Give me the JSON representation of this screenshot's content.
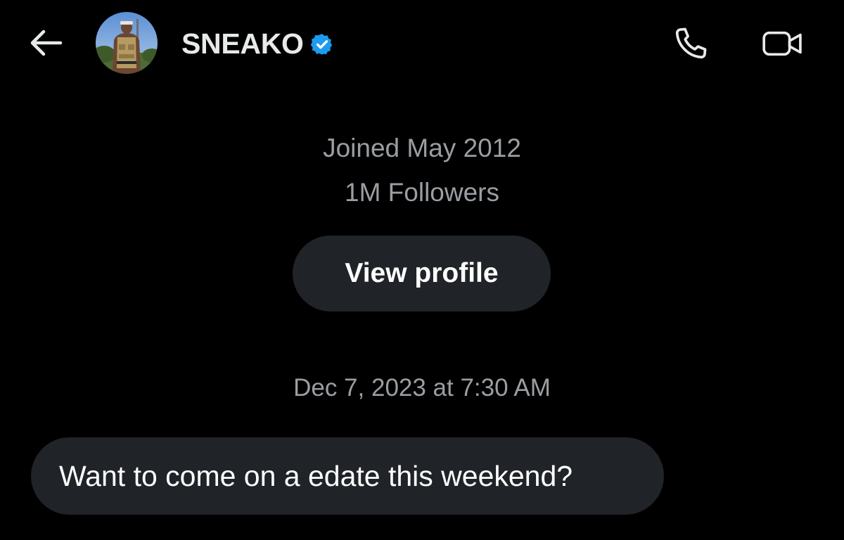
{
  "header": {
    "display_name": "SNEAKO",
    "avatar_icon": "avatar-photo",
    "back_icon": "arrow-left-icon",
    "verified_icon": "verified-badge-icon",
    "call_icon": "phone-icon",
    "video_icon": "video-camera-icon"
  },
  "profile": {
    "joined": "Joined May 2012",
    "followers": "1M Followers",
    "view_profile_label": "View profile"
  },
  "conversation": {
    "timestamp": "Dec 7, 2023 at 7:30 AM",
    "messages": [
      {
        "text": "Want to come on a edate this weekend?"
      }
    ]
  },
  "colors": {
    "background": "#000000",
    "primary_text": "#e7e9ea",
    "secondary_text": "#9a9ea3",
    "bubble": "#202327",
    "verified": "#1d9bf0"
  }
}
